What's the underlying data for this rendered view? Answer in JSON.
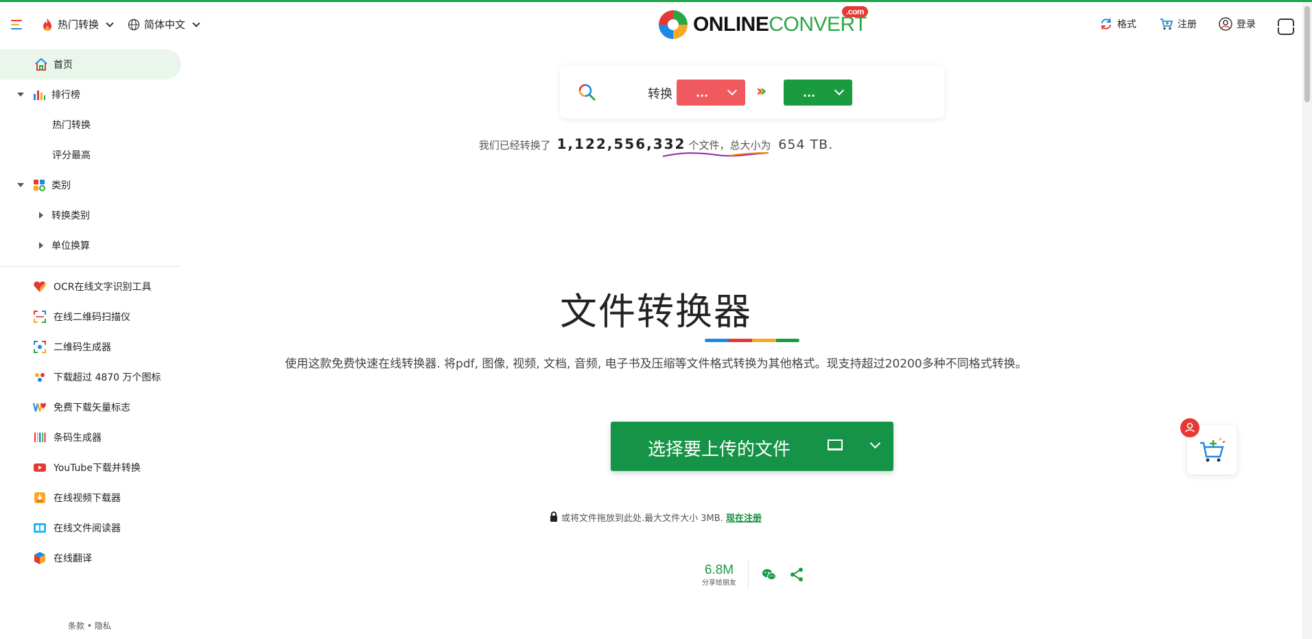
{
  "header": {
    "hot_convert": "热门转换",
    "language": "简体中文",
    "logo": {
      "online": "ONLINE",
      "convert": "CONVERT",
      "com": ".com"
    },
    "formats": "格式",
    "register": "注册",
    "login": "登录"
  },
  "sidebar": {
    "home": "首页",
    "ranking": "排行榜",
    "ranking_children": [
      "热门转换",
      "评分最高"
    ],
    "category": "类别",
    "category_children": [
      "转换类别",
      "单位换算"
    ],
    "tools": [
      {
        "label": "OCR在线文字识别工具",
        "icon": "heart-icon"
      },
      {
        "label": "在线二维码扫描仪",
        "icon": "qr-scan-icon"
      },
      {
        "label": "二维码生成器",
        "icon": "qr-generator-icon"
      },
      {
        "label": "下载超过 4870 万个图标",
        "icon": "icons-download-icon"
      },
      {
        "label": "免费下载矢量标志",
        "icon": "vector-logo-icon"
      },
      {
        "label": "条码生成器",
        "icon": "barcode-icon"
      },
      {
        "label": "YouTube下载并转换",
        "icon": "youtube-icon"
      },
      {
        "label": "在线视频下载器",
        "icon": "video-download-icon"
      },
      {
        "label": "在线文件阅读器",
        "icon": "file-reader-icon"
      },
      {
        "label": "在线翻译",
        "icon": "translate-icon"
      }
    ],
    "footer": "条款 • 隐私"
  },
  "search": {
    "label": "转换",
    "from": "...",
    "to": "..."
  },
  "stats": {
    "prefix": "我们已经转换了",
    "count": "1,122,556,332",
    "middle": "个文件，总大小为",
    "size": "654 TB."
  },
  "main": {
    "title": "文件转换器",
    "description": "使用这款免费快速在线转换器. 将pdf, 图像, 视频, 文档, 音频, 电子书及压缩等文件格式转换为其他格式。现支持超过20200多种不同格式转换。",
    "upload_label": "选择要上传的文件",
    "drop_note": "或将文件拖放到此处.最大文件大小 3MB.",
    "register_link": "现在注册",
    "share_count": "6.8M",
    "share_label": "分享给朋友"
  },
  "colors": {
    "green": "#1a9b40",
    "red": "#f05a5e",
    "colorbar": [
      "#1e88e5",
      "#e53935",
      "#f9a825",
      "#1a9b40"
    ]
  }
}
